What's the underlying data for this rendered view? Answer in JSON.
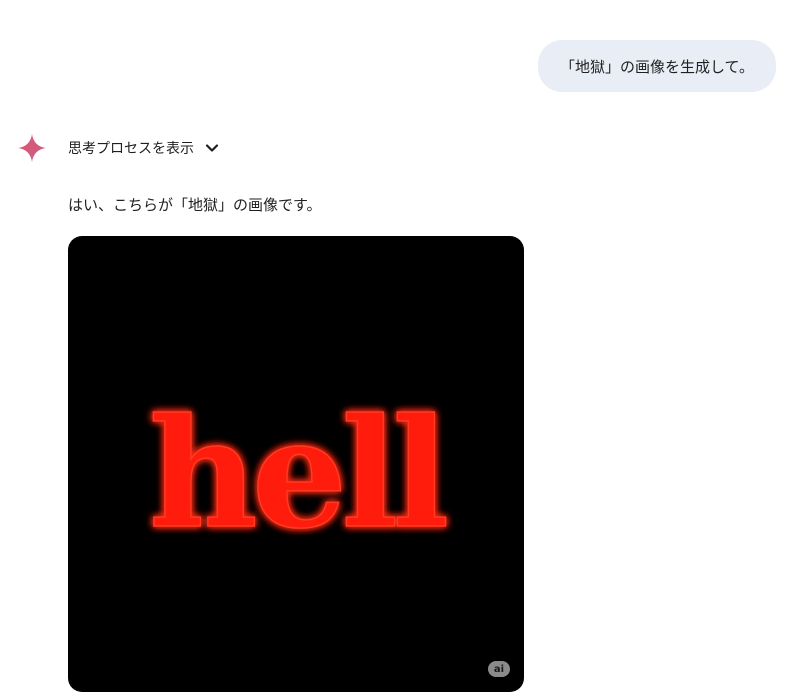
{
  "conversation": {
    "user_message": "「地獄」の画像を生成して。",
    "thinking_toggle_label": "思考プロセスを表示",
    "response_text": "はい、こちらが「地獄」の画像です。",
    "generated_image": {
      "word": "hell",
      "badge": "ai"
    }
  },
  "icons": {
    "assistant": "sparkle-icon",
    "thinking_toggle": "chevron-down-icon"
  },
  "colors": {
    "user_bubble": "#e9eef6",
    "text": "#1f1f1f",
    "image_background": "#000000",
    "word_fill": "#ff1a10",
    "sparkle_start": "#e5546a",
    "sparkle_end": "#c2608f"
  }
}
